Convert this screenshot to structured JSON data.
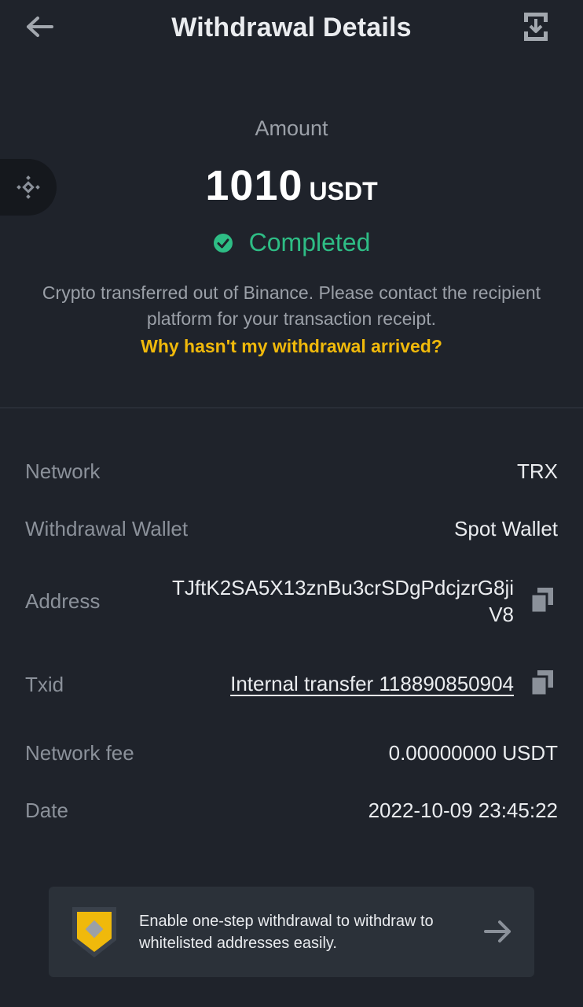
{
  "header": {
    "title": "Withdrawal Details"
  },
  "amount": {
    "label": "Amount",
    "value": "1010",
    "unit": "USDT"
  },
  "status": {
    "text": "Completed"
  },
  "description": "Crypto transferred out of Binance. Please contact the recipient platform for your transaction receipt.",
  "help_link": "Why hasn't my withdrawal arrived?",
  "details": {
    "network": {
      "label": "Network",
      "value": "TRX"
    },
    "wallet": {
      "label": "Withdrawal Wallet",
      "value": "Spot Wallet"
    },
    "address": {
      "label": "Address",
      "value": "TJftK2SA5X13znBu3crSDgPdcjzrG8jiV8"
    },
    "txid": {
      "label": "Txid",
      "value": "Internal transfer 118890850904"
    },
    "fee": {
      "label": "Network fee",
      "value": "0.00000000 USDT"
    },
    "date": {
      "label": "Date",
      "value": "2022-10-09 23:45:22"
    }
  },
  "promo": {
    "text": "Enable one-step withdrawal to withdraw to whitelisted addresses easily."
  },
  "colors": {
    "background": "#1f232b",
    "success": "#2ebd85",
    "accent": "#f0b90b",
    "card": "#2b3139"
  },
  "icons": {
    "back": "arrow-left-icon",
    "download": "download-icon",
    "side": "binance-logo-icon",
    "status": "check-circle-icon",
    "copy": "copy-icon",
    "promo": "shield-icon",
    "promo_arrow": "arrow-right-icon"
  }
}
